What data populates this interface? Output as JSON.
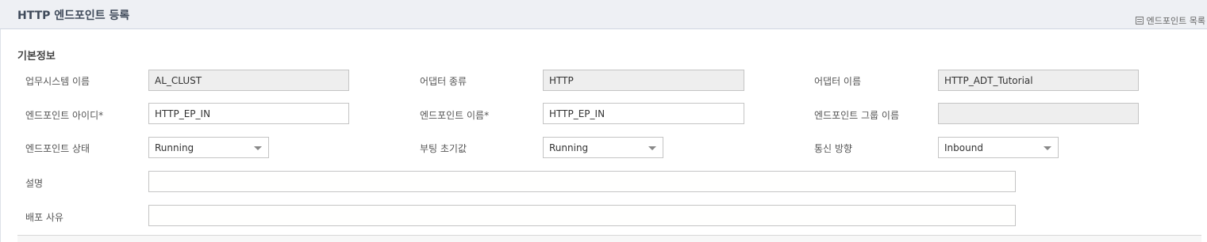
{
  "header": {
    "title": "HTTP 엔드포인트 등록",
    "list_link": "엔드포인트 목록"
  },
  "section": {
    "title": "기본정보"
  },
  "fields": {
    "business_system_name": {
      "label": "업무시스템 이름",
      "value": "AL_CLUST"
    },
    "adapter_type": {
      "label": "어댑터 종류",
      "value": "HTTP"
    },
    "adapter_name": {
      "label": "어댑터 이름",
      "value": "HTTP_ADT_Tutorial"
    },
    "endpoint_id": {
      "label": "엔드포인트 아이디*",
      "value": "HTTP_EP_IN"
    },
    "endpoint_name": {
      "label": "엔드포인트 이름*",
      "value": "HTTP_EP_IN"
    },
    "endpoint_group_name": {
      "label": "엔드포인트 그룹 이름",
      "value": ""
    },
    "endpoint_status": {
      "label": "엔드포인트 상태",
      "value": "Running"
    },
    "booting_default": {
      "label": "부팅 초기값",
      "value": "Running"
    },
    "comm_direction": {
      "label": "통신 방향",
      "value": "Inbound"
    },
    "description": {
      "label": "설명",
      "value": ""
    },
    "deploy_reason": {
      "label": "배포 사유",
      "value": ""
    }
  }
}
